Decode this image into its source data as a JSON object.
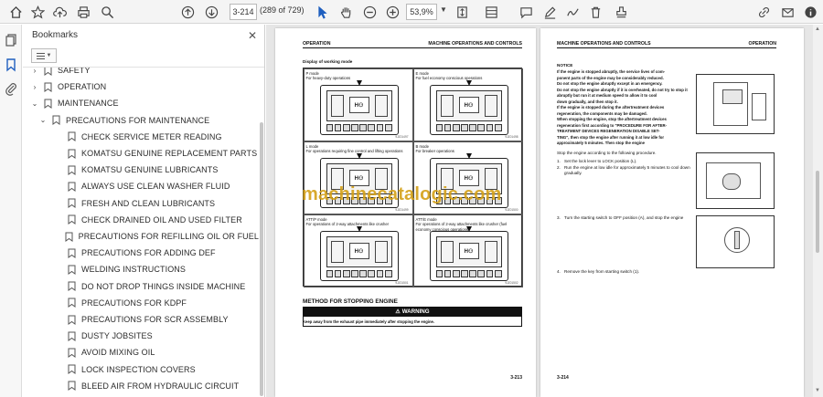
{
  "toolbar": {
    "page_current": "3-214",
    "page_count": "(289 of 729)",
    "zoom": "53,9%"
  },
  "bookmarks": {
    "title": "Bookmarks",
    "items": [
      {
        "label": "SAFETY",
        "level": 0,
        "chevron": "›"
      },
      {
        "label": "OPERATION",
        "level": 0,
        "chevron": "›"
      },
      {
        "label": "MAINTENANCE",
        "level": 0,
        "chevron": "⌄"
      },
      {
        "label": "PRECAUTIONS FOR MAINTENANCE",
        "level": 1,
        "chevron": "⌄"
      },
      {
        "label": "CHECK SERVICE METER READING",
        "level": 2,
        "chevron": ""
      },
      {
        "label": "KOMATSU GENUINE REPLACEMENT PARTS",
        "level": 2,
        "chevron": ""
      },
      {
        "label": "KOMATSU GENUINE LUBRICANTS",
        "level": 2,
        "chevron": ""
      },
      {
        "label": "ALWAYS USE CLEAN WASHER FLUID",
        "level": 2,
        "chevron": ""
      },
      {
        "label": "FRESH AND CLEAN LUBRICANTS",
        "level": 2,
        "chevron": ""
      },
      {
        "label": "CHECK DRAINED OIL AND USED FILTER",
        "level": 2,
        "chevron": ""
      },
      {
        "label": "PRECAUTIONS FOR REFILLING OIL OR FUEL",
        "level": 2,
        "chevron": ""
      },
      {
        "label": "PRECAUTIONS FOR ADDING DEF",
        "level": 2,
        "chevron": ""
      },
      {
        "label": "WELDING INSTRUCTIONS",
        "level": 2,
        "chevron": ""
      },
      {
        "label": "DO NOT DROP THINGS INSIDE MACHINE",
        "level": 2,
        "chevron": ""
      },
      {
        "label": "PRECAUTIONS FOR KDPF",
        "level": 2,
        "chevron": ""
      },
      {
        "label": "PRECAUTIONS FOR SCR ASSEMBLY",
        "level": 2,
        "chevron": ""
      },
      {
        "label": "DUSTY JOBSITES",
        "level": 2,
        "chevron": ""
      },
      {
        "label": "AVOID MIXING OIL",
        "level": 2,
        "chevron": ""
      },
      {
        "label": "LOCK INSPECTION COVERS",
        "level": 2,
        "chevron": ""
      },
      {
        "label": "BLEED AIR FROM HYDRAULIC CIRCUIT",
        "level": 2,
        "chevron": ""
      }
    ]
  },
  "left_page": {
    "header_left": "OPERATION",
    "header_right": "MACHINE OPERATIONS AND CONTROLS",
    "subtitle": "Display of working mode",
    "modes": [
      {
        "title": "P mode",
        "desc": "For heavy-duty operations",
        "code": "9JZ01497"
      },
      {
        "title": "E mode",
        "desc": "For fuel economy conscious operations",
        "code": "9JZ01498"
      },
      {
        "title": "L mode",
        "desc": "For operations requiring fine control and lifting operations",
        "code": "9JZ01499"
      },
      {
        "title": "B mode",
        "desc": "For breaker operations",
        "code": "9JZ01500"
      },
      {
        "title": "ATT/P mode",
        "desc": "For operations of 2-way attachments like crusher",
        "code": "9JZ01501"
      },
      {
        "title": "ATT/E mode",
        "desc": "For operations of 2-way attachments like crusher (fuel economy conscious operations)",
        "code": "9JZ01502"
      }
    ],
    "section_title": "METHOD FOR STOPPING ENGINE",
    "warning_label": "WARNING",
    "warning_text": "Keep away from the exhaust pipe immediately after stopping the engine.",
    "page_number": "3-213"
  },
  "right_page": {
    "header_left": "MACHINE OPERATIONS AND CONTROLS",
    "header_right": "OPERATION",
    "notice_label": "NOTICE",
    "notice_lines": [
      "If the engine is stopped abruptly, the service lives of com-",
      "ponent parts of the engine may be considerably reduced.",
      "Do not stop the engine abruptly except in an emergency.",
      "Do not stop the engine abruptly if it is overheated, do not try to stop it",
      "abruptly but run it at medium speed to allow it to cool",
      "down gradually, and then stop it.",
      "If the engine is stopped during the aftertreatment devices",
      "regeneration, the components may be damaged.",
      "When stopping the engine, stop the aftertreatment devices",
      "regeneration first according to \"PROCEDURE FOR AFTER-",
      "TREATMENT DEVICES REGENERATION DISABLE SET-",
      "TING\", then stop the engine after running it at low idle for",
      "approximately 5 minutes. Then stop the engine"
    ],
    "intro": "Stop the engine according to the following procedure.",
    "steps": [
      {
        "n": "1.",
        "text": "Set the lock lever to LOCK position (L)."
      },
      {
        "n": "2.",
        "text": "Run the engine at low idle for approximately 5 minutes to cool down gradually."
      },
      {
        "n": "3.",
        "text": "Turn the starting switch to OFF position (A), and stop the engine"
      },
      {
        "n": "4.",
        "text": "Remove the key from starting switch (1)."
      }
    ],
    "page_number": "3-214"
  },
  "watermark": "machinecatalogic.com"
}
